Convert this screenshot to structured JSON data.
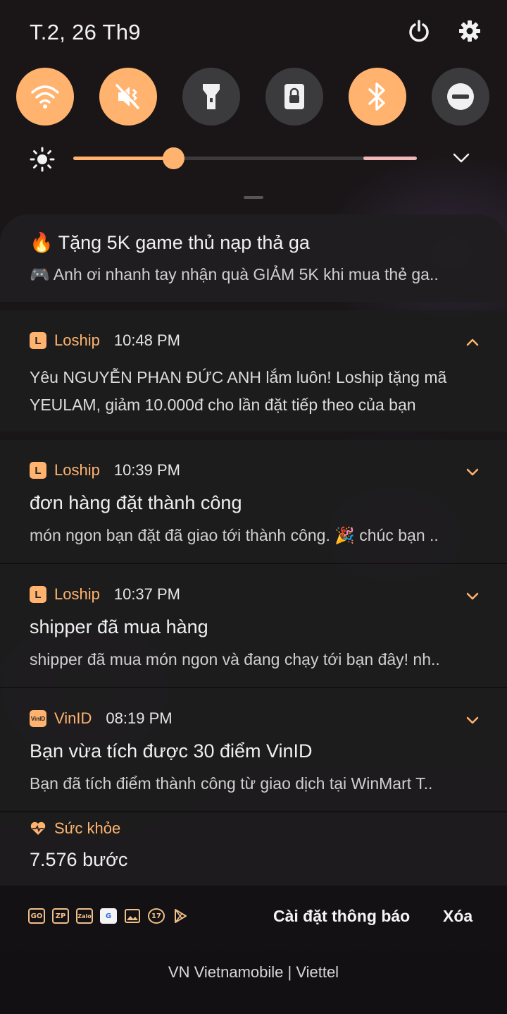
{
  "status": {
    "date": "T.2, 26 Th9"
  },
  "quick_settings": [
    {
      "name": "wifi",
      "state": "on"
    },
    {
      "name": "sound-off",
      "state": "on"
    },
    {
      "name": "flashlight",
      "state": "off"
    },
    {
      "name": "screen-lock-rotation",
      "state": "off"
    },
    {
      "name": "bluetooth",
      "state": "on"
    },
    {
      "name": "do-not-disturb",
      "state": "off"
    }
  ],
  "brightness": {
    "level": 0.29
  },
  "colors": {
    "accent": "#ffb36e",
    "panel": "#1e1c1e",
    "text": "#f0f0f0"
  },
  "notifications": [
    {
      "title": "🔥 Tặng 5K game thủ nạp thả ga",
      "body": "🎮 Anh ơi nhanh tay nhận quà GIẢM 5K khi mua thẻ ga.."
    },
    {
      "app": "Loship",
      "time": "10:48 PM",
      "expanded": true,
      "body_line1": "Yêu NGUYỄN PHAN ĐỨC ANH lắm luôn! Loship tặng mã",
      "body_line2": "YEULAM, giảm 10.000đ cho lần đặt tiếp theo của bạn"
    },
    {
      "app": "Loship",
      "time": "10:39 PM",
      "title": "đơn hàng đặt thành công",
      "body": "món ngon bạn đặt đã giao tới thành công. 🎉 chúc bạn .."
    },
    {
      "app": "Loship",
      "time": "10:37 PM",
      "title": "shipper đã mua hàng",
      "body": "shipper đã mua món ngon và đang chạy tới bạn đây! nh.."
    },
    {
      "app": "VinID",
      "time": "08:19 PM",
      "title": "Bạn vừa tích được 30 điểm VinID",
      "body": "Bạn đã tích điểm thành công từ giao dịch tại WinMart T.."
    },
    {
      "app": "Sức khỏe",
      "title": "7.576 bước"
    }
  ],
  "footer": {
    "mini_icons": [
      "GO",
      "ZP",
      "Zalo",
      "G",
      "img",
      "17",
      "play"
    ],
    "settings_label": "Cài đặt thông báo",
    "clear_label": "Xóa"
  },
  "carrier": "VN Vietnamobile | Viettel"
}
